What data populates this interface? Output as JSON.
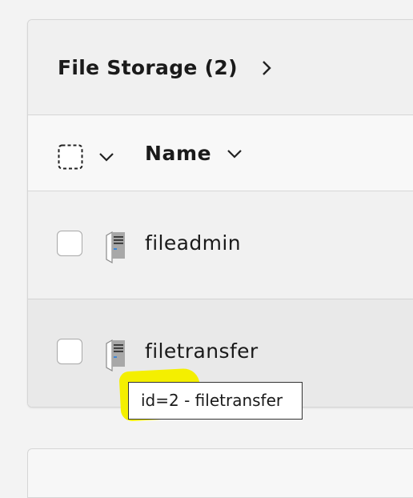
{
  "panel": {
    "title": "File Storage (2)"
  },
  "table": {
    "column_name_label": "Name",
    "rows": [
      {
        "label": "fileadmin",
        "icon": "server-file-icon"
      },
      {
        "label": "filetransfer",
        "icon": "server-file-icon"
      }
    ]
  },
  "tooltip": {
    "text": "id=2 - filetransfer"
  },
  "colors": {
    "highlight": "#f4ef00",
    "icon_blue": "#3a86d8",
    "icon_gray": "#a8a8a8"
  }
}
